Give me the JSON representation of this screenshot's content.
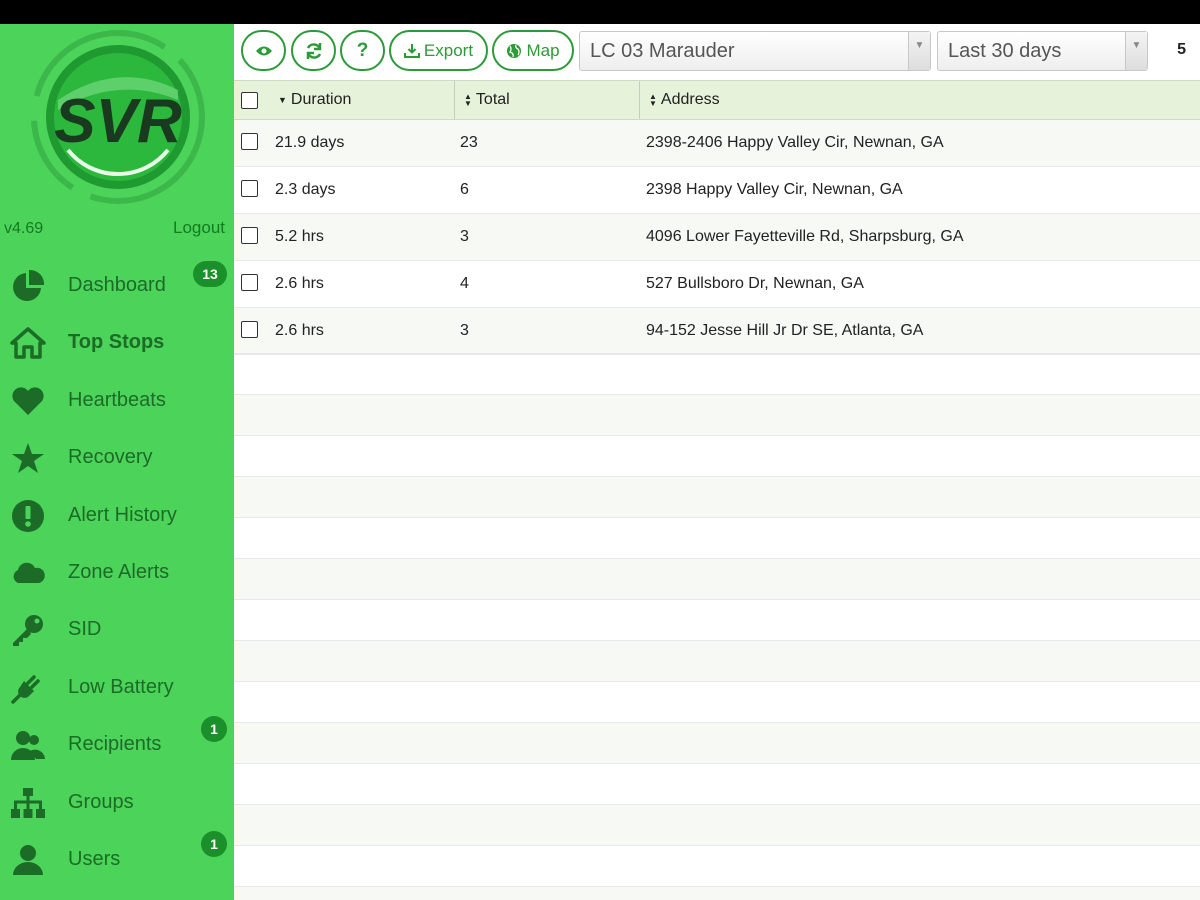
{
  "app": {
    "version": "v4.69",
    "logout_label": "Logout",
    "logo_text": "SVR",
    "accent_color": "#4cd35a",
    "dark_accent": "#1c6b26"
  },
  "sidebar": {
    "items": [
      {
        "label": "Dashboard",
        "icon": "pie-chart-icon",
        "badge": "13"
      },
      {
        "label": "Top Stops",
        "icon": "home-icon",
        "active": true
      },
      {
        "label": "Heartbeats",
        "icon": "heart-icon"
      },
      {
        "label": "Recovery",
        "icon": "star-icon"
      },
      {
        "label": "Alert History",
        "icon": "exclamation-icon"
      },
      {
        "label": "Zone Alerts",
        "icon": "cloud-icon"
      },
      {
        "label": "SID",
        "icon": "key-icon"
      },
      {
        "label": "Low Battery",
        "icon": "plug-icon"
      },
      {
        "label": "Recipients",
        "icon": "users-icon",
        "badge": "1"
      },
      {
        "label": "Groups",
        "icon": "sitemap-icon"
      },
      {
        "label": "Users",
        "icon": "user-icon",
        "badge": "1"
      }
    ]
  },
  "toolbar": {
    "view_icon": "eye-icon",
    "refresh_icon": "refresh-icon",
    "help_icon": "question-icon",
    "export_label": "Export",
    "map_label": "Map",
    "vehicle_select": "LC 03 Marauder",
    "range_select": "Last 30 days",
    "count": "5"
  },
  "table": {
    "columns": [
      "Duration",
      "Total",
      "Address"
    ],
    "rows": [
      {
        "duration": "21.9 days",
        "total": "23",
        "address": "2398-2406 Happy Valley Cir, Newnan, GA"
      },
      {
        "duration": "2.3 days",
        "total": "6",
        "address": "2398 Happy Valley Cir, Newnan, GA"
      },
      {
        "duration": "5.2 hrs",
        "total": "3",
        "address": "4096 Lower Fayetteville Rd, Sharpsburg, GA"
      },
      {
        "duration": "2.6 hrs",
        "total": "4",
        "address": "527 Bullsboro Dr, Newnan, GA"
      },
      {
        "duration": "2.6 hrs",
        "total": "3",
        "address": "94-152 Jesse Hill Jr Dr SE, Atlanta, GA"
      }
    ]
  }
}
